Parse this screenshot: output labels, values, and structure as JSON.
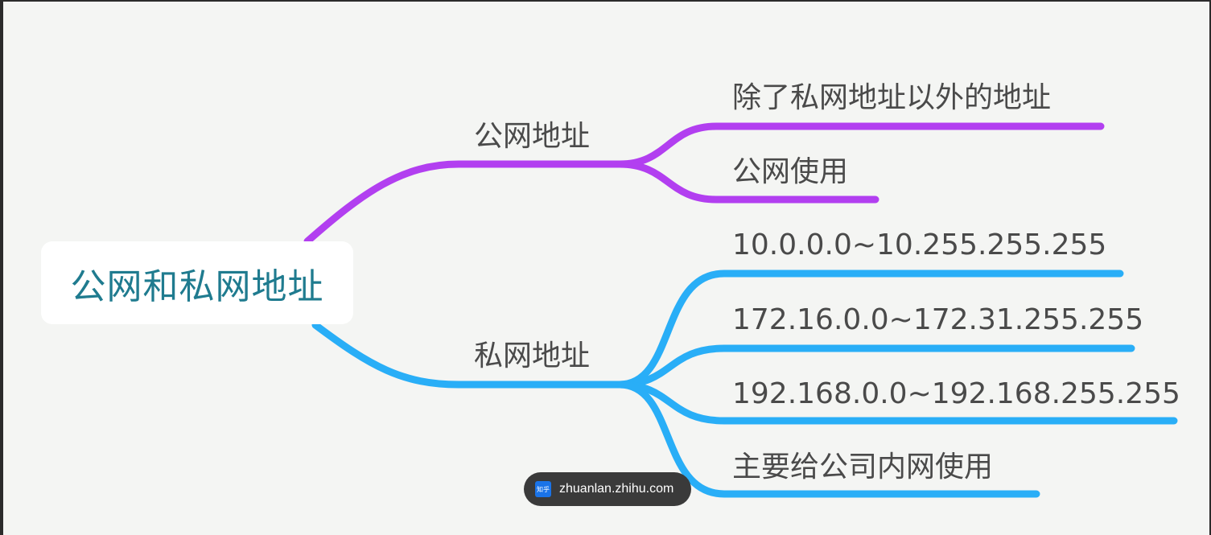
{
  "root": {
    "label": "公网和私网地址"
  },
  "branches": [
    {
      "label": "公网地址",
      "color": "#b23ff0",
      "children": [
        "除了私网地址以外的地址",
        "公网使用"
      ]
    },
    {
      "label": "私网地址",
      "color": "#29aef7",
      "children": [
        "10.0.0.0~10.255.255.255",
        "172.16.0.0~172.31.255.255",
        "192.168.0.0~192.168.255.255",
        "主要给公司内网使用"
      ]
    }
  ],
  "watermark": {
    "icon": "zhihu-logo-icon",
    "icon_text": "知乎",
    "text": "zhuanlan.zhihu.com"
  }
}
